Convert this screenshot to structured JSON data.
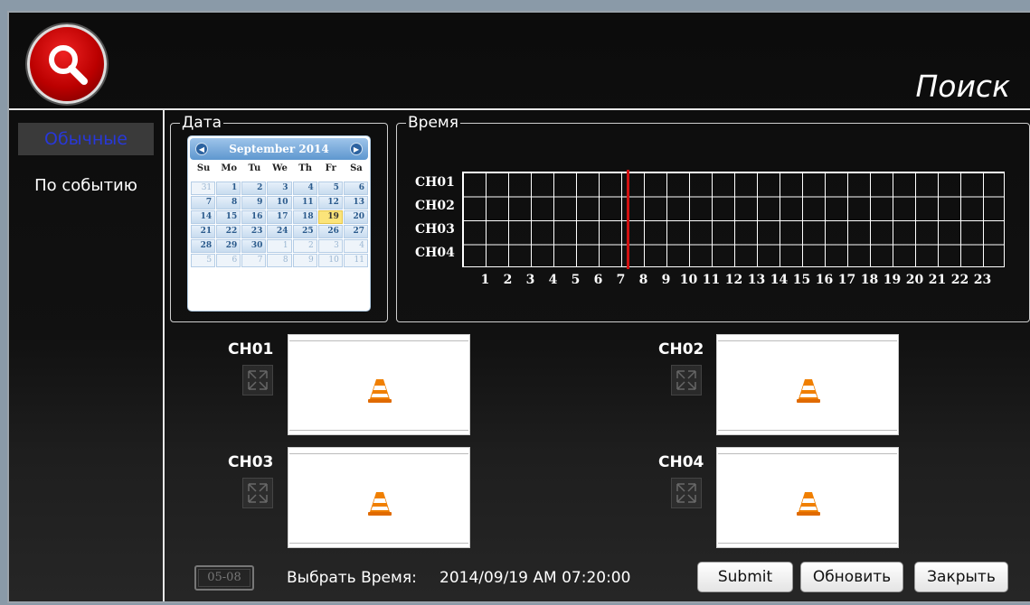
{
  "header": {
    "title": "Поиск"
  },
  "sidebar": {
    "items": [
      {
        "label": "Обычные",
        "active": true
      },
      {
        "label": "По событию",
        "active": false
      }
    ]
  },
  "date_panel": {
    "label": "Дата",
    "calendar": {
      "month_label": "September 2014",
      "weekdays": [
        "Su",
        "Mo",
        "Tu",
        "We",
        "Th",
        "Fr",
        "Sa"
      ],
      "selected_day": "19",
      "days": [
        "31",
        "1",
        "2",
        "3",
        "4",
        "5",
        "6",
        "7",
        "8",
        "9",
        "10",
        "11",
        "12",
        "13",
        "14",
        "15",
        "16",
        "17",
        "18",
        "19",
        "20",
        "21",
        "22",
        "23",
        "24",
        "25",
        "26",
        "27",
        "28",
        "29",
        "30",
        "1",
        "2",
        "3",
        "4",
        "5",
        "6",
        "7",
        "8",
        "9",
        "10",
        "11"
      ]
    }
  },
  "time_panel": {
    "label": "Время",
    "channels": [
      "CH01",
      "CH02",
      "CH03",
      "CH04"
    ],
    "hours": [
      "1",
      "2",
      "3",
      "4",
      "5",
      "6",
      "7",
      "8",
      "9",
      "10",
      "11",
      "12",
      "13",
      "14",
      "15",
      "16",
      "17",
      "18",
      "19",
      "20",
      "21",
      "22",
      "23"
    ],
    "marker_hour": 7.33
  },
  "videos": [
    {
      "label": "CH01"
    },
    {
      "label": "CH02"
    },
    {
      "label": "CH03"
    },
    {
      "label": "CH04"
    }
  ],
  "footer": {
    "segment_label": "05-08",
    "select_time_label": "Выбрать Время:",
    "select_time_value": "2014/09/19  AM  07:20:00",
    "submit": "Submit",
    "refresh": "Обновить",
    "close": "Закрыть"
  },
  "colors": {
    "accent_active": "#2838d8",
    "marker": "#d01010",
    "today": "#fbe47a"
  }
}
